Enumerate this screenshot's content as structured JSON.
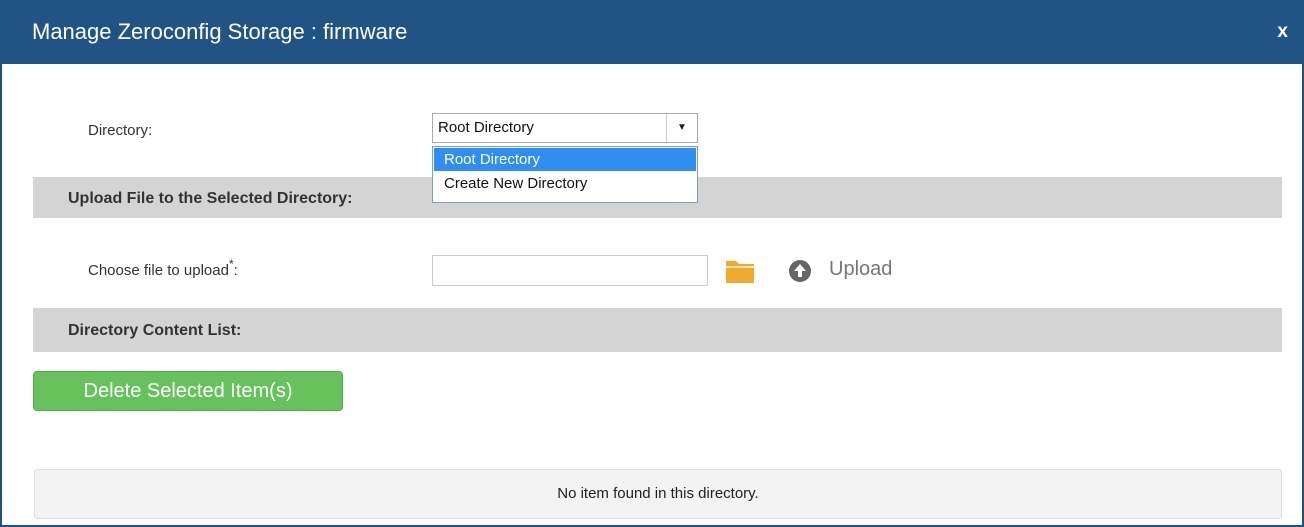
{
  "dialog": {
    "title": "Manage Zeroconfig Storage : firmware",
    "close_label": "x"
  },
  "directory": {
    "label": "Directory:",
    "selected": "Root Directory",
    "options": [
      "Root Directory",
      "Create New Directory"
    ]
  },
  "upload_section": {
    "heading": "Upload File to the Selected Directory:",
    "choose_label": "Choose file to upload",
    "required_mark": "*",
    "choose_suffix": ":",
    "file_value": "",
    "upload_label": "Upload"
  },
  "list_section": {
    "heading": "Directory Content List:",
    "delete_label": "Delete Selected Item(s)",
    "empty_message": "No item found in this directory."
  },
  "colors": {
    "titlebar": "#225385",
    "accent_selected": "#2f8ef0",
    "delete_button": "#67c15d",
    "folder_icon": "#f0a830"
  }
}
